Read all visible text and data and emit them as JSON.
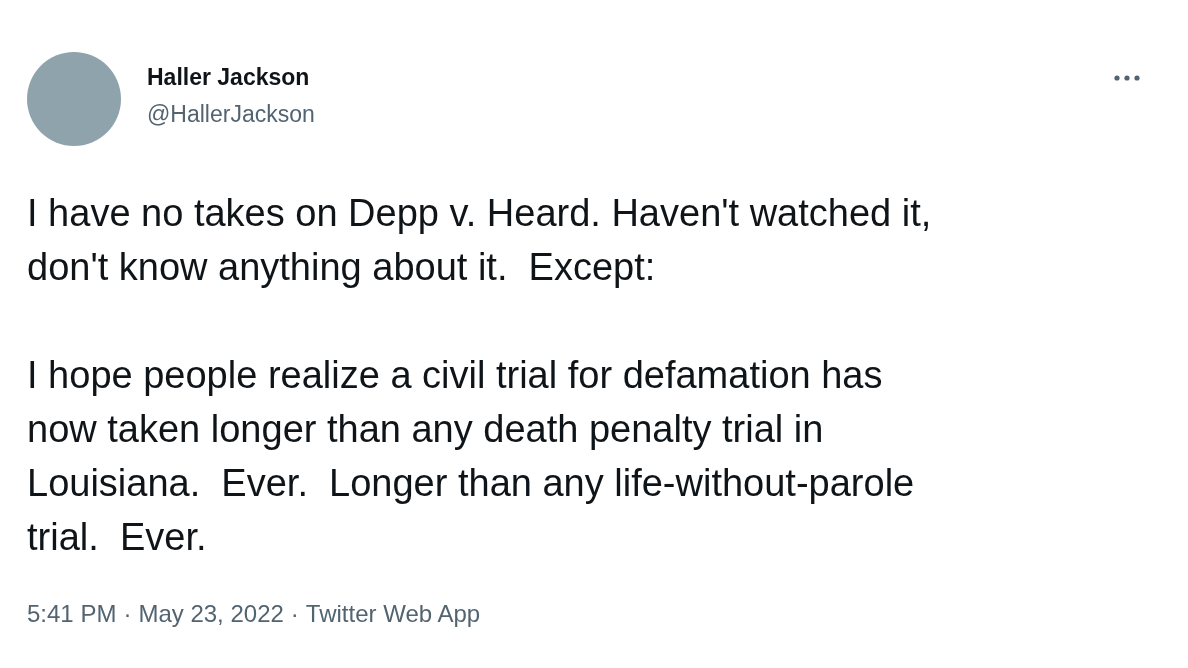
{
  "author": {
    "name": "Haller Jackson",
    "handle": "@HallerJackson"
  },
  "paragraphs": [
    "I have no takes on Depp v. Heard. Haven't watched it, don't know anything about it.  Except:",
    "I hope people realize a civil trial for defamation has now taken longer than any death penalty trial in Louisiana.  Ever.  Longer than any life-without-parole trial.  Ever."
  ],
  "meta": {
    "time": "5:41 PM",
    "separator": "·",
    "date": "May 23, 2022",
    "source": "Twitter Web App"
  }
}
